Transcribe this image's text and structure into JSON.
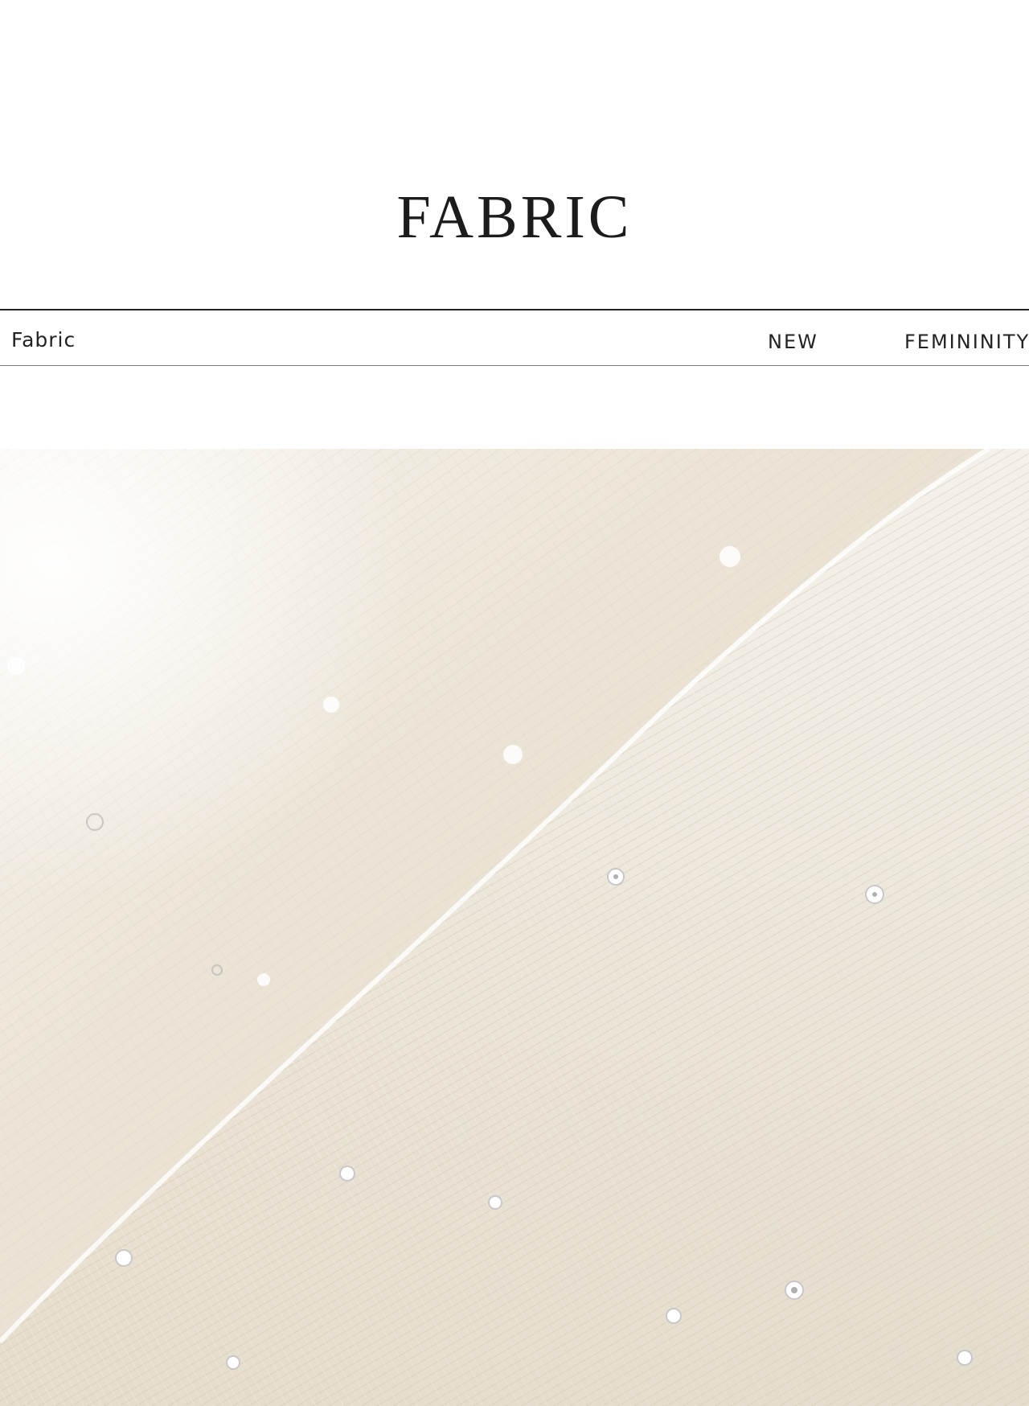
{
  "header": {
    "title": "FABRIC"
  },
  "band": {
    "left_label": "Fabric",
    "right_label_1": "NEW",
    "right_label_2": "FEMININITY"
  },
  "photo": {
    "subject": "fabric-closeup",
    "colors": {
      "cream": "#efe9dc",
      "highlight": "#faf8f2",
      "shadow": "#ddd3c0"
    }
  }
}
